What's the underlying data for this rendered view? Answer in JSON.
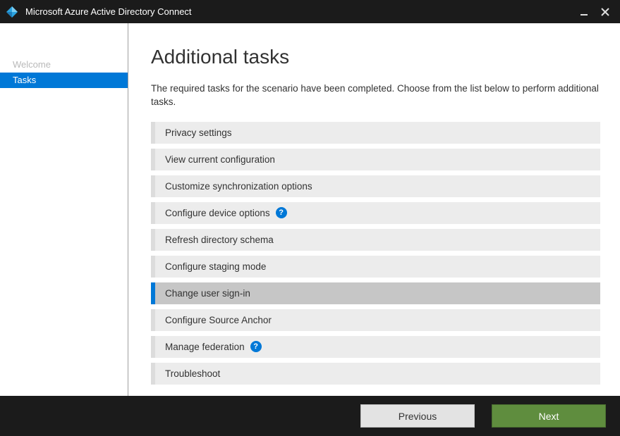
{
  "window": {
    "title": "Microsoft Azure Active Directory Connect"
  },
  "sidebar": {
    "items": [
      {
        "label": "Welcome",
        "active": false
      },
      {
        "label": "Tasks",
        "active": true
      }
    ]
  },
  "main": {
    "heading": "Additional tasks",
    "description": "The required tasks for the scenario have been completed. Choose from the list below to perform additional tasks.",
    "tasks": [
      {
        "label": "Privacy settings",
        "help": false,
        "selected": false
      },
      {
        "label": "View current configuration",
        "help": false,
        "selected": false
      },
      {
        "label": "Customize synchronization options",
        "help": false,
        "selected": false
      },
      {
        "label": "Configure device options",
        "help": true,
        "selected": false
      },
      {
        "label": "Refresh directory schema",
        "help": false,
        "selected": false
      },
      {
        "label": "Configure staging mode",
        "help": false,
        "selected": false
      },
      {
        "label": "Change user sign-in",
        "help": false,
        "selected": true
      },
      {
        "label": "Configure Source Anchor",
        "help": false,
        "selected": false
      },
      {
        "label": "Manage federation",
        "help": true,
        "selected": false
      },
      {
        "label": "Troubleshoot",
        "help": false,
        "selected": false
      }
    ]
  },
  "footer": {
    "previous_label": "Previous",
    "next_label": "Next"
  }
}
